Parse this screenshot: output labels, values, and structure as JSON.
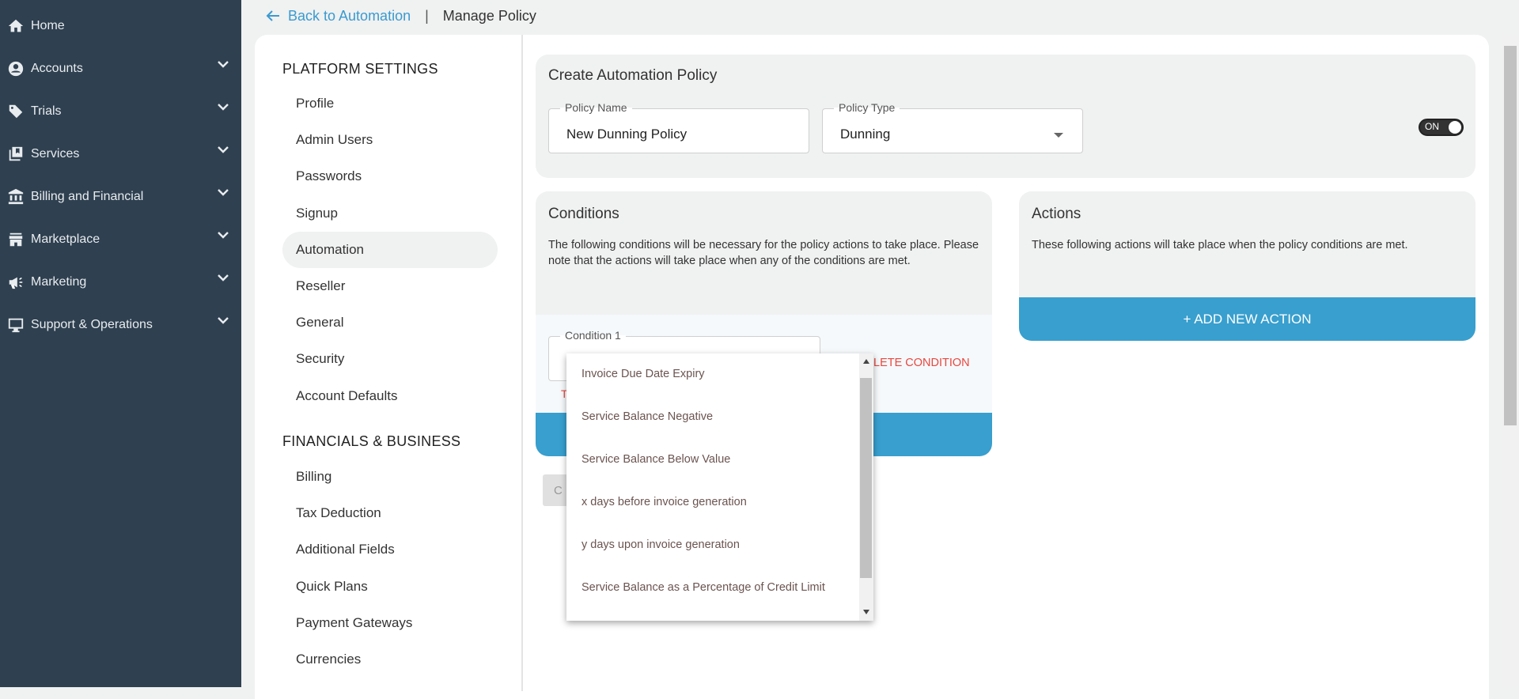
{
  "sidebar": {
    "items": [
      {
        "label": "Home",
        "icon": "home-icon",
        "chevron": false
      },
      {
        "label": "Accounts",
        "icon": "account-circle-icon",
        "chevron": true
      },
      {
        "label": "Trials",
        "icon": "tag-icon",
        "chevron": true
      },
      {
        "label": "Services",
        "icon": "library-icon",
        "chevron": true
      },
      {
        "label": "Billing and Financial",
        "icon": "bank-icon",
        "chevron": true
      },
      {
        "label": "Marketplace",
        "icon": "store-icon",
        "chevron": true
      },
      {
        "label": "Marketing",
        "icon": "megaphone-icon",
        "chevron": true
      },
      {
        "label": "Support & Operations",
        "icon": "monitor-icon",
        "chevron": true
      }
    ]
  },
  "breadcrumb": {
    "back": "Back to Automation",
    "separator": "|",
    "title": "Manage Policy"
  },
  "settings": {
    "platform_heading": "PLATFORM SETTINGS",
    "platform_items": [
      "Profile",
      "Admin Users",
      "Passwords",
      "Signup",
      "Automation",
      "Reseller",
      "General",
      "Security",
      "Account Defaults"
    ],
    "financial_heading": "FINANCIALS & BUSINESS",
    "financial_items": [
      "Billing",
      "Tax Deduction",
      "Additional Fields",
      "Quick Plans",
      "Payment Gateways",
      "Currencies"
    ],
    "active": "Automation"
  },
  "policy": {
    "title": "Create Automation Policy",
    "name_label": "Policy Name",
    "name_value": "New Dunning Policy",
    "type_label": "Policy Type",
    "type_value": "Dunning",
    "toggle": "ON"
  },
  "conditions": {
    "title": "Conditions",
    "description": "The following conditions will be necessary for the policy actions to take place. Please note that the actions will take place when any of the conditions are met.",
    "condition_label": "Condition 1",
    "delete_label": "LETE CONDITION",
    "hint_partial": "T",
    "button_partial": "C"
  },
  "actions": {
    "title": "Actions",
    "description": "These following actions will take place when the policy conditions are met.",
    "add_label": "+ ADD NEW ACTION"
  },
  "dropdown": {
    "options": [
      "Invoice Due Date Expiry",
      "Service Balance Negative",
      "Service Balance Below Value",
      "x days before invoice generation",
      "y days upon invoice generation",
      "Service Balance as a Percentage of Credit Limit"
    ]
  },
  "colors": {
    "sidebar": "#2f4050",
    "accent": "#389fce",
    "danger": "#e8473f"
  }
}
